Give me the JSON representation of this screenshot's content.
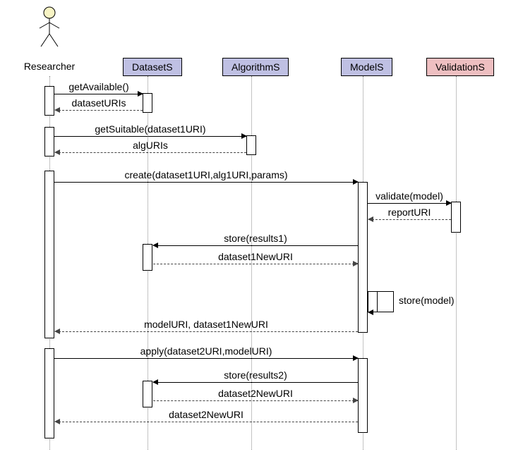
{
  "actor": {
    "label": "Researcher"
  },
  "participants": {
    "datasetS": "DatasetS",
    "algorithmS": "AlgorithmS",
    "modelS": "ModelS",
    "validationS": "ValidationS"
  },
  "messages": {
    "m1": "getAvailable()",
    "r1": "datasetURIs",
    "m2": "getSuitable(dataset1URI)",
    "r2": "algURIs",
    "m3": "create(dataset1URI,alg1URI,params)",
    "m4": "validate(model)",
    "r4": "reportURI",
    "m5": "store(results1)",
    "r5": "dataset1NewURI",
    "m6": "store(model)",
    "r6": "modelURI, dataset1NewURI",
    "m7": "apply(dataset2URI,modelURI)",
    "m8": "store(results2)",
    "r8": "dataset2NewURI",
    "r9": "dataset2NewURI"
  },
  "chart_data": {
    "type": "sequence-diagram",
    "actor": "Researcher",
    "participants": [
      "DatasetS",
      "AlgorithmS",
      "ModelS",
      "ValidationS"
    ],
    "interactions": [
      {
        "from": "Researcher",
        "to": "DatasetS",
        "label": "getAvailable()",
        "style": "call"
      },
      {
        "from": "DatasetS",
        "to": "Researcher",
        "label": "datasetURIs",
        "style": "return"
      },
      {
        "from": "Researcher",
        "to": "AlgorithmS",
        "label": "getSuitable(dataset1URI)",
        "style": "call"
      },
      {
        "from": "AlgorithmS",
        "to": "Researcher",
        "label": "algURIs",
        "style": "return"
      },
      {
        "from": "Researcher",
        "to": "ModelS",
        "label": "create(dataset1URI,alg1URI,params)",
        "style": "call"
      },
      {
        "from": "ModelS",
        "to": "ValidationS",
        "label": "validate(model)",
        "style": "call"
      },
      {
        "from": "ValidationS",
        "to": "ModelS",
        "label": "reportURI",
        "style": "return"
      },
      {
        "from": "ModelS",
        "to": "DatasetS",
        "label": "store(results1)",
        "style": "call"
      },
      {
        "from": "DatasetS",
        "to": "ModelS",
        "label": "dataset1NewURI",
        "style": "return"
      },
      {
        "from": "ModelS",
        "to": "ModelS",
        "label": "store(model)",
        "style": "self"
      },
      {
        "from": "ModelS",
        "to": "Researcher",
        "label": "modelURI, dataset1NewURI",
        "style": "return"
      },
      {
        "from": "Researcher",
        "to": "ModelS",
        "label": "apply(dataset2URI,modelURI)",
        "style": "call"
      },
      {
        "from": "ModelS",
        "to": "DatasetS",
        "label": "store(results2)",
        "style": "call"
      },
      {
        "from": "DatasetS",
        "to": "ModelS",
        "label": "dataset2NewURI",
        "style": "return"
      },
      {
        "from": "ModelS",
        "to": "Researcher",
        "label": "dataset2NewURI",
        "style": "return"
      }
    ]
  }
}
